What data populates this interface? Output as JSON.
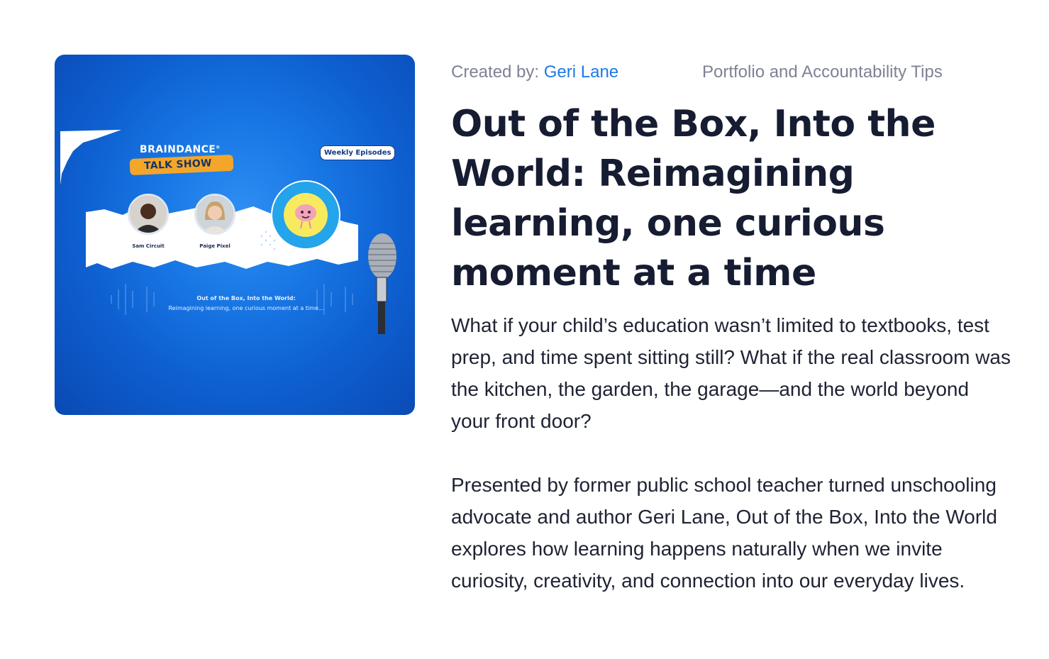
{
  "cover": {
    "brand": "BRAINDANCE",
    "brand_mark": "®",
    "show": "TALK SHOW",
    "badge": "Weekly Episodes",
    "hosts": [
      {
        "name": "Sam Circuit"
      },
      {
        "name": "Paige Pixel"
      }
    ],
    "caption_title": "Out of the Box, Into the World:",
    "caption_sub": "Reimagining learning, one curious moment at a time...",
    "colors": {
      "background": "#1877e4",
      "badge_orange": "#f4a62a",
      "logo_blue": "#24a4ea",
      "logo_yellow": "#f8ea5e"
    }
  },
  "meta": {
    "created_label": "Created by: ",
    "author": "Geri Lane",
    "category": "Portfolio and Accountability Tips"
  },
  "title": "Out of the Box, Into the World: Reimagining learning, one curious moment at a time",
  "description": [
    "What if your child’s education wasn’t limited to textbooks, test prep, and time spent sitting still? What if the real classroom was the kitchen, the garden, the garage—and the world beyond your front door?",
    "Presented by former public school teacher turned unschooling advocate and author Geri Lane, Out of the Box, Into the World explores how learning happens naturally when we invite curiosity, creativity, and connection into our everyday lives."
  ]
}
